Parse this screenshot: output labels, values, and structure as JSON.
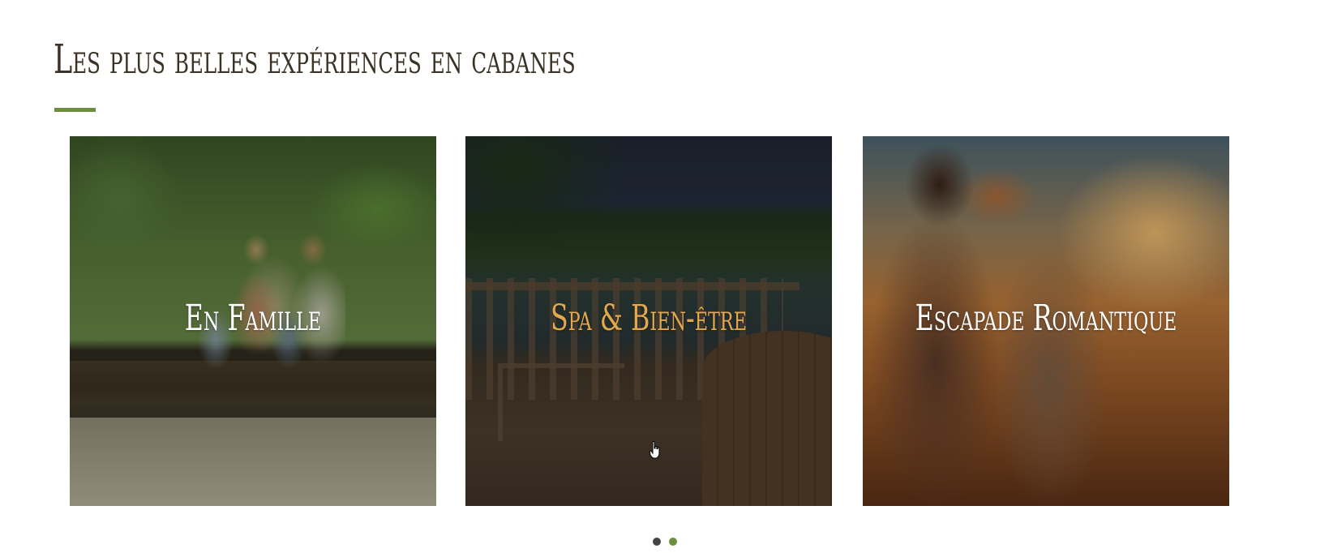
{
  "section": {
    "title": "Les plus belles expériences en cabanes"
  },
  "cards": [
    {
      "label": "En Famille",
      "image": "family-in-forest-photo"
    },
    {
      "label": "Spa & Bien-être",
      "image": "spa-deck-lake-photo"
    },
    {
      "label": "Escapade Romantique",
      "image": "couple-sunset-photo"
    }
  ],
  "carousel": {
    "page_count": 2,
    "active_page": 2
  },
  "colors": {
    "accent": "#6b8f3c",
    "title_text": "#3b3226",
    "highlight_label": "#e3a84e"
  },
  "icons": {
    "cursor": "hand-pointer-icon"
  }
}
